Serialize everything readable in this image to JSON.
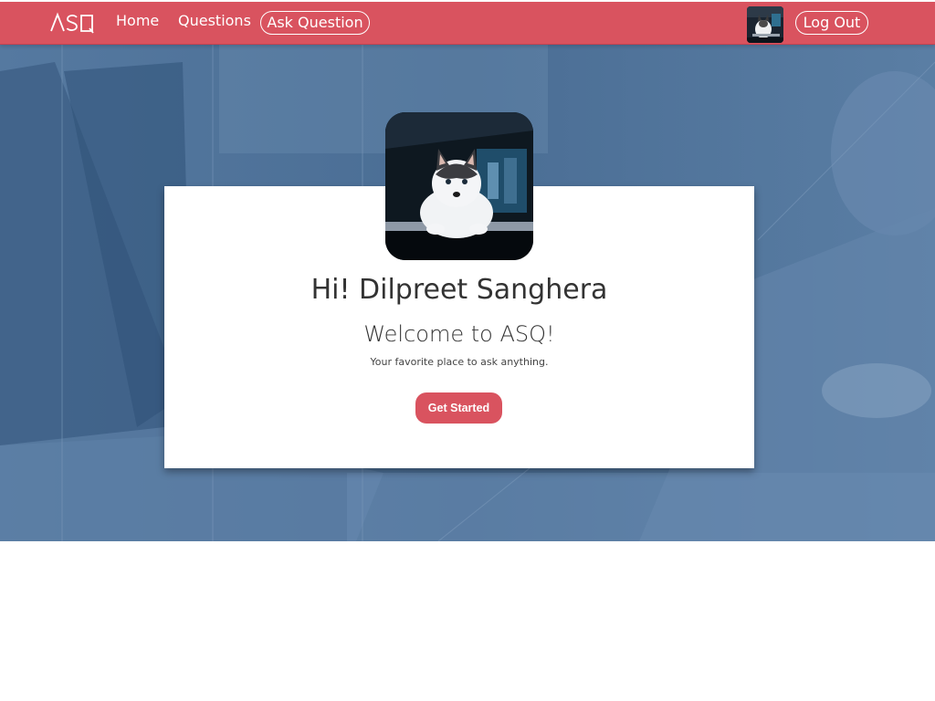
{
  "navbar": {
    "logo_text": "ASQ",
    "home_label": "Home",
    "questions_label": "Questions",
    "ask_label": "Ask Question",
    "logout_label": "Log Out",
    "avatar_icon": "husky-dog-avatar"
  },
  "main": {
    "greeting": "Hi! Dilpreet Sanghera",
    "welcome": "Welcome to ASQ!",
    "tagline": "Your favorite place to ask anything.",
    "cta_label": "Get Started"
  },
  "colors": {
    "brand": "#d9535f",
    "hero_overlay": "#4a6f97",
    "card": "#ffffff",
    "text": "#333333"
  }
}
